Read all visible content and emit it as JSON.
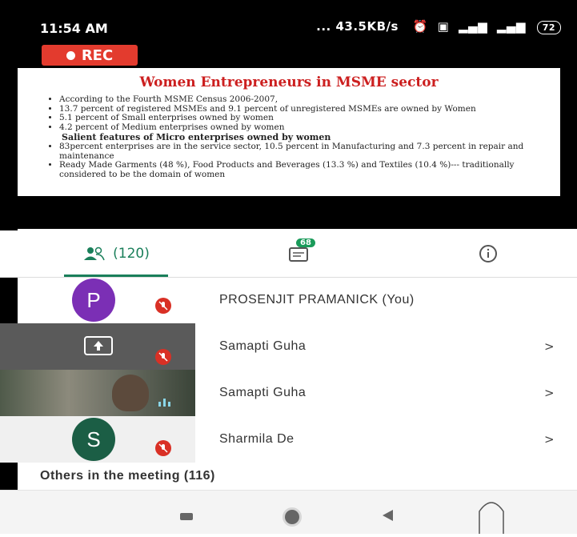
{
  "status_bar": {
    "time": "11:54 AM",
    "speed": "... 43.5KB/s",
    "battery": "72"
  },
  "recording": {
    "label": "REC"
  },
  "slide": {
    "title": "Women Entrepreneurs in MSME sector",
    "bullets": [
      "According to the Fourth MSME Census 2006-2007,",
      "13.7 percent of registered MSMEs and 9.1 percent of unregistered MSMEs are owned by Women",
      "5.1 percent of Small enterprises owned by women",
      "4.2 percent of Medium enterprises owned by women"
    ],
    "subheading": "Salient features of Micro enterprises owned by women",
    "bullets2": [
      "83percent enterprises are in the service sector, 10.5 percent in Manufacturing and 7.3 percent in repair and maintenance",
      "Ready Made Garments (48 %), Food Products and Beverages (13.3 %) and Textiles (10.4 %)--- traditionally considered to be the domain of women"
    ]
  },
  "tabs": {
    "people_count": "(120)",
    "chat_badge": "68"
  },
  "participants": [
    {
      "initial": "P",
      "name": "PROSENJIT PRAMANICK (You)",
      "avatar_color": "#7b2fb5"
    },
    {
      "name": "Samapti Guha",
      "chevron": ">"
    },
    {
      "name": "Samapti Guha",
      "chevron": ">"
    },
    {
      "initial": "S",
      "name": "Sharmila De",
      "chevron": ">",
      "avatar_color": "#1b5e45"
    }
  ],
  "others": {
    "header": "Others in the meeting (116)"
  },
  "colors": {
    "accent": "#1a7f5a",
    "rec": "#e33b2e",
    "mute": "#d93025",
    "slide_title": "#cc1f1f"
  }
}
